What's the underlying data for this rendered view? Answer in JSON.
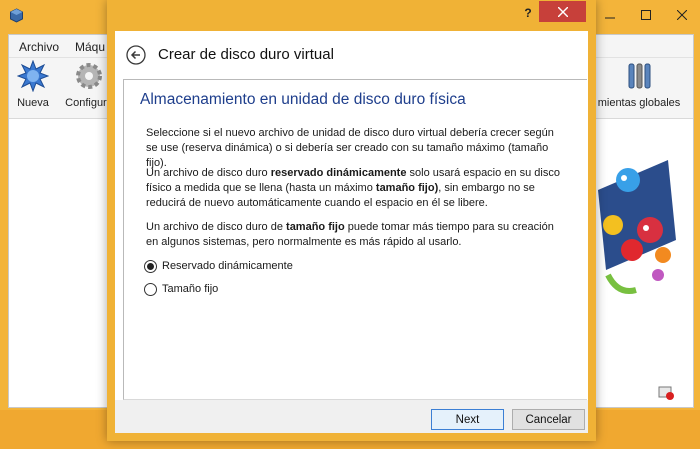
{
  "main": {
    "menu": {
      "file": "Archivo",
      "machine": "Máqu"
    },
    "toolbar": {
      "new": "Nueva",
      "settings": "Configura",
      "global_tools": "mientas globales"
    }
  },
  "dialog": {
    "help": "?",
    "title": "Crear de disco duro virtual",
    "section_title": "Almacenamiento en unidad de disco duro física",
    "intro": "Seleccione si el nuevo archivo de unidad de disco duro virtual debería crecer según se use (reserva dinámica) o si debería ser creado con su tamaño máximo (tamaño fijo).",
    "dynamic_pre": "Un archivo de disco duro ",
    "dynamic_bold": "reservado dinámicamente",
    "dynamic_mid": " solo usará espacio en su disco físico a medida que se llena (hasta un máximo ",
    "dynamic_bold2": "tamaño fijo)",
    "dynamic_post": ", sin embargo no se reducirá de nuevo automáticamente cuando el espacio en él se libere.",
    "fixed_pre": "Un archivo de disco duro de ",
    "fixed_bold": "tamaño fijo",
    "fixed_post": " puede tomar más tiempo para su creación en algunos sistemas, pero normalmente es más rápido al usarlo.",
    "options": [
      {
        "label": "Reservado dinámicamente",
        "selected": true
      },
      {
        "label": "Tamaño fijo",
        "selected": false
      }
    ],
    "next": "Next",
    "cancel": "Cancelar"
  },
  "colors": {
    "accent_title": "#1e3e8c",
    "window_frame": "#f0b236",
    "close_button": "#c7403a"
  }
}
